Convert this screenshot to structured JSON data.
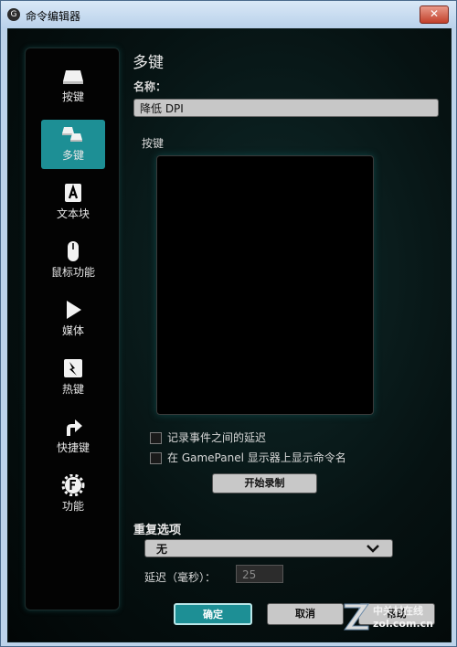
{
  "window": {
    "title": "命令编辑器",
    "close_label": "✕"
  },
  "sidebar": {
    "items": [
      {
        "label": "按键",
        "icon": "keycap-icon",
        "active": false
      },
      {
        "label": "多键",
        "icon": "multi-key-icon",
        "active": true
      },
      {
        "label": "文本块",
        "icon": "text-block-icon",
        "active": false
      },
      {
        "label": "鼠标功能",
        "icon": "mouse-icon",
        "active": false
      },
      {
        "label": "媒体",
        "icon": "play-icon",
        "active": false
      },
      {
        "label": "热键",
        "icon": "hotkey-icon",
        "active": false
      },
      {
        "label": "快捷键",
        "icon": "shortcut-arrow-icon",
        "active": false
      },
      {
        "label": "功能",
        "icon": "function-gear-icon",
        "active": false
      }
    ],
    "accent_color": "#1d8f95"
  },
  "main": {
    "title": "多键",
    "name_label": "名称：",
    "name_value": "降低 DPI",
    "keys_label": "按键",
    "checkboxes": [
      {
        "label": "记录事件之间的延迟",
        "checked": false
      },
      {
        "label": "在 GamePanel 显示器上显示命令名",
        "checked": false
      }
    ],
    "record_button": "开始录制",
    "repeat_label": "重复选项",
    "repeat_selected": "无",
    "delay_label": "延迟（毫秒）：",
    "delay_value": "25"
  },
  "footer": {
    "ok_label": "确定",
    "cancel_label": "取消",
    "help_label": "帮助"
  },
  "watermark": {
    "cn": "中关村在线",
    "en": "zol.com.cn"
  }
}
